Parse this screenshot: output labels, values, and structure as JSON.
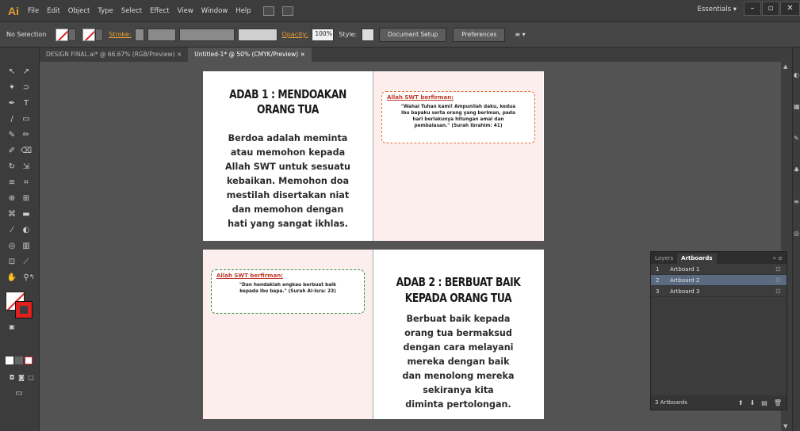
{
  "menubar": {
    "logo": "Ai",
    "items": [
      "File",
      "Edit",
      "Object",
      "Type",
      "Select",
      "Effect",
      "View",
      "Window",
      "Help"
    ],
    "workspace": "Essentials"
  },
  "control": {
    "selection": "No Selection",
    "stroke_label": "Stroke:",
    "opacity_label": "Opacity:",
    "opacity_value": "100%",
    "style_label": "Style:",
    "doc_setup": "Document Setup",
    "preferences": "Preferences"
  },
  "tabs": [
    {
      "label": "DESIGN FINAL.ai* @ 66.67% (RGB/Preview)",
      "active": false
    },
    {
      "label": "Untitled-1* @ 50% (CMYK/Preview)",
      "active": true
    }
  ],
  "tab_close": "×",
  "adab1": {
    "title_line1": "ADAB 1 : MENDOAKAN",
    "title_line2": "ORANG TUA",
    "body_line1": "Berdoa adalah meminta",
    "body_line2": "atau memohon kepada",
    "body_line3": "Allah SWT untuk sesuatu",
    "body_line4": "kebaikan. Memohon doa",
    "body_line5": "mestilah disertakan niat",
    "body_line6": "dan memohon dengan",
    "body_line7": "hati yang sangat ikhlas.",
    "quote_head": "Allah SWT berfirman:",
    "quote_line1": "\"Wahai Tuhan kami! Ampunilah daku, kedua",
    "quote_line2": "ibu bapaku serta orang yang beriman, pada",
    "quote_line3": "hari berlakunya hitungan amal dan",
    "quote_line4": "pembalasan.\" (Surah Ibrahim: 41)"
  },
  "adab2": {
    "title_line1": "ADAB 2 : BERBUAT BAIK",
    "title_line2": "KEPADA ORANG TUA",
    "body_line1": "Berbuat baik kepada",
    "body_line2": "orang tua bermaksud",
    "body_line3": "dengan cara melayani",
    "body_line4": "mereka dengan baik",
    "body_line5": "dan menolong mereka",
    "body_line6": "sekiranya kita",
    "body_line7": "diminta pertolongan.",
    "quote_head": "Allah SWT berfirman:",
    "quote_line1": "\"Dan hendaklah engkau berbuat baik",
    "quote_line2": "kepada ibu bapa.\" (Surah Al-Isra: 23)"
  },
  "panel": {
    "tab_layers": "Layers",
    "tab_artboards": "Artboards",
    "rows": [
      {
        "num": "1",
        "name": "Artboard 1"
      },
      {
        "num": "2",
        "name": "Artboard 2"
      },
      {
        "num": "3",
        "name": "Artboard 3"
      }
    ],
    "footer": "3 Artboards"
  }
}
